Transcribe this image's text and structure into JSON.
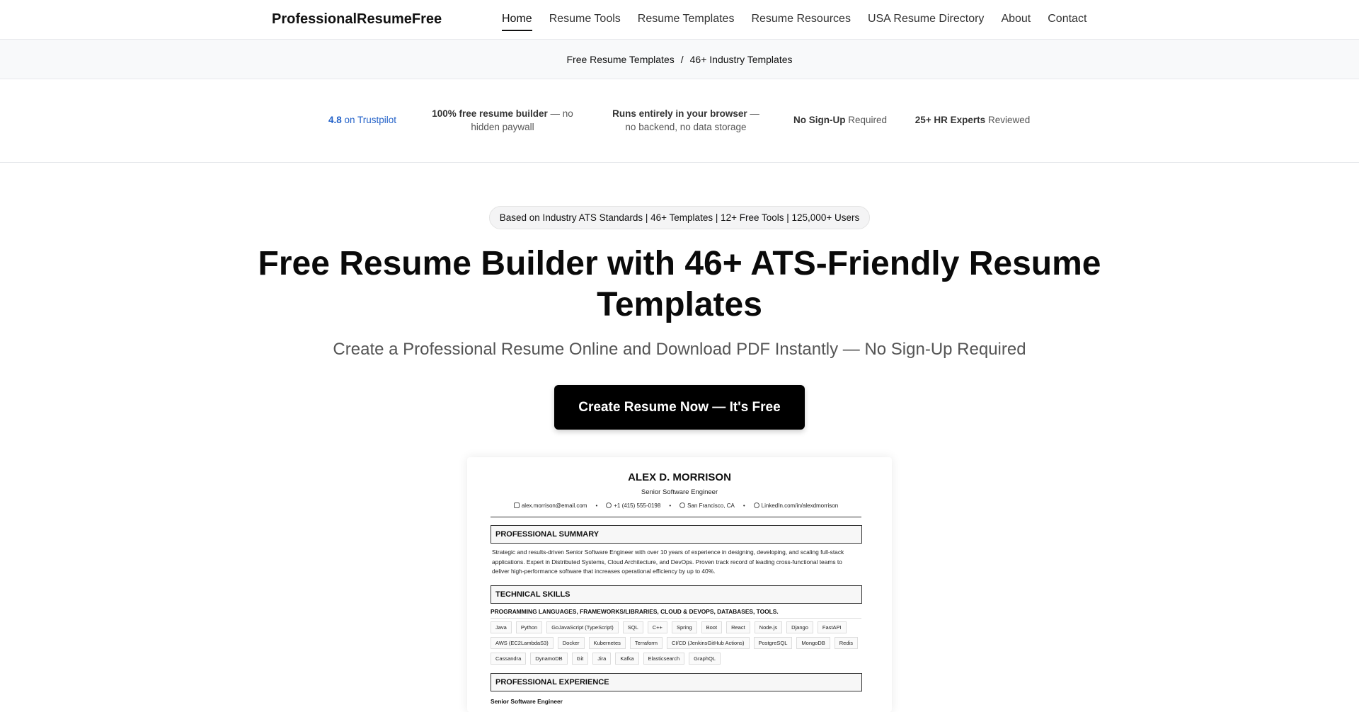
{
  "nav": {
    "logo": "ProfessionalResumeFree",
    "links": [
      "Home",
      "Resume Tools",
      "Resume Templates",
      "Resume Resources",
      "USA Resume Directory",
      "About",
      "Contact"
    ]
  },
  "breadcrumb": {
    "items": [
      "Free Resume Templates",
      "46+ Industry Templates"
    ],
    "separator": "/"
  },
  "trust": {
    "rating_value": "4.8",
    "rating_label": "on Trustpilot",
    "free_bold": "100% free resume builder",
    "free_rest": " — no hidden paywall",
    "browser_bold": "Runs entirely in your browser",
    "browser_rest": " — no backend, no data storage",
    "signup_bold": "No Sign-Up",
    "signup_rest": " Required",
    "experts_bold": "25+ HR Experts",
    "experts_rest": " Reviewed"
  },
  "hero": {
    "pill": "Based on Industry ATS Standards | 46+ Templates | 12+ Free Tools | 125,000+ Users",
    "title": "Free Resume Builder with 46+ ATS-Friendly Resume Templates",
    "subtitle": "Create a Professional Resume Online and Download PDF Instantly — No Sign-Up Required",
    "cta": "Create Resume Now — It's Free"
  },
  "resume": {
    "name": "ALEX D. MORRISON",
    "title": "Senior Software Engineer",
    "email": "alex.morrison@email.com",
    "phone": "+1 (415) 555-0198",
    "location": "San Francisco, CA",
    "linkedin": "LinkedIn.com/in/alexdmorrison",
    "summary_heading": "PROFESSIONAL SUMMARY",
    "summary": "Strategic and results-driven Senior Software Engineer with over 10 years of experience in designing, developing, and scaling full-stack applications. Expert in Distributed Systems, Cloud Architecture, and DevOps. Proven track record of leading cross-functional teams to deliver high-performance software that increases operational efficiency by up to 40%.",
    "skills_heading": "TECHNICAL SKILLS",
    "skills_subheading": "PROGRAMMING LANGUAGES, FRAMEWORKS/LIBRARIES, CLOUD & DEVOPS, DATABASES, TOOLS.",
    "skills": [
      "Java",
      "Python",
      "GoJavaScript (TypeScript)",
      "SQL",
      "C++",
      "Spring",
      "Boot",
      "React",
      "Node.js",
      "Django",
      "FastAPI",
      "AWS (EC2LambdaS3)",
      "Docker",
      "Kubernetes",
      "Terraform",
      "CI/CD (JenkinsGitHub Actions)",
      "PostgreSQL",
      "MongoDB",
      "Redis",
      "Cassandra",
      "DynamoDB",
      "Git",
      "Jira",
      "Kafka",
      "Elasticsearch",
      "GraphQL"
    ],
    "experience_heading": "PROFESSIONAL EXPERIENCE",
    "job_title": "Senior Software Engineer"
  }
}
